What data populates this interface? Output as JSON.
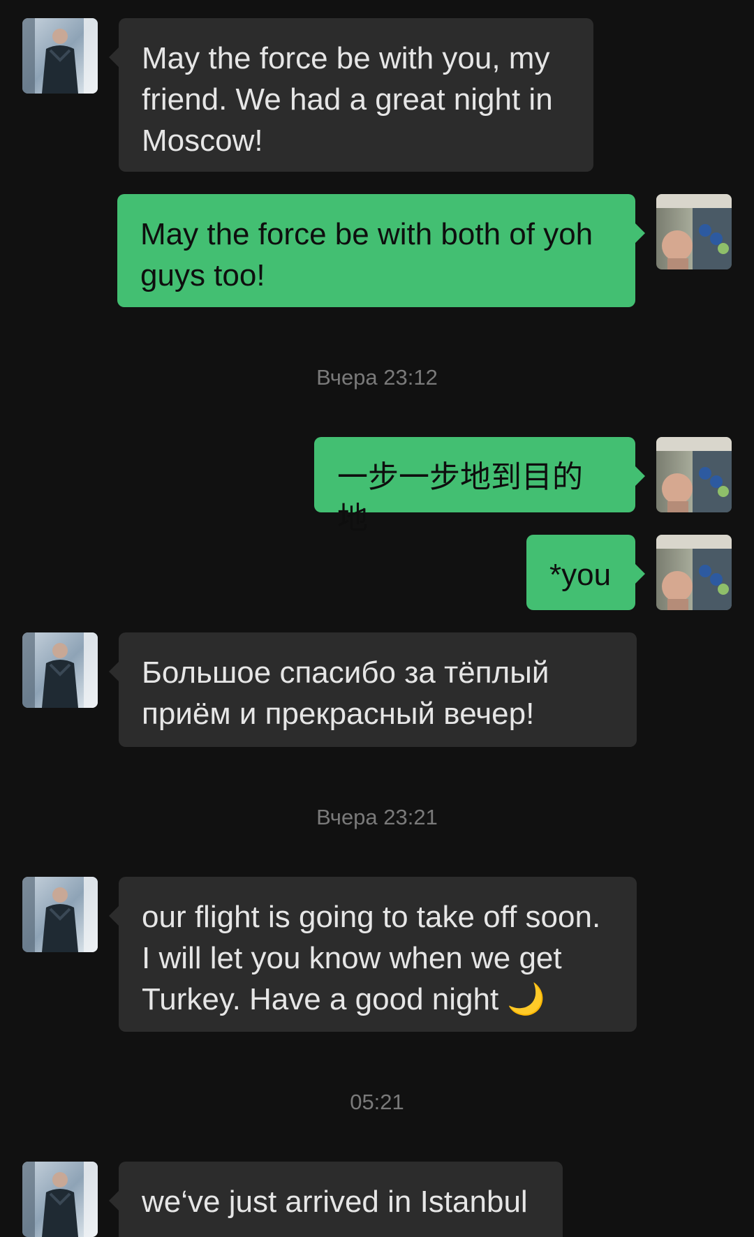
{
  "messages": [
    {
      "side": "in",
      "text": "May the force be with you, my friend. We had a great night in Moscow!"
    },
    {
      "side": "out",
      "text": "May the force be with both of yoh guys too!"
    },
    {
      "timestamp": "Вчера 23:12"
    },
    {
      "side": "out",
      "text": "一步一步地到目的地"
    },
    {
      "side": "out",
      "text": "*you"
    },
    {
      "side": "in",
      "text": "Большое спасибо за тёплый приём и прекрасный вечер!"
    },
    {
      "timestamp": "Вчера 23:21"
    },
    {
      "side": "in",
      "text": "our flight is going to take off soon. I will let you know when we get Turkey. Have a good night",
      "emoji": "🌙"
    },
    {
      "timestamp": "05:21"
    },
    {
      "side": "in",
      "text": "we‘ve just arrived in Istanbul"
    }
  ],
  "colors": {
    "background": "#111111",
    "incoming_bubble": "#2c2c2c",
    "outgoing_bubble": "#43bf72",
    "timestamp_text": "#7a7a7a"
  },
  "icons": {
    "contact_avatar": "contact-avatar-photo",
    "user_avatar": "user-avatar-photo",
    "emoji": "crescent-moon"
  }
}
